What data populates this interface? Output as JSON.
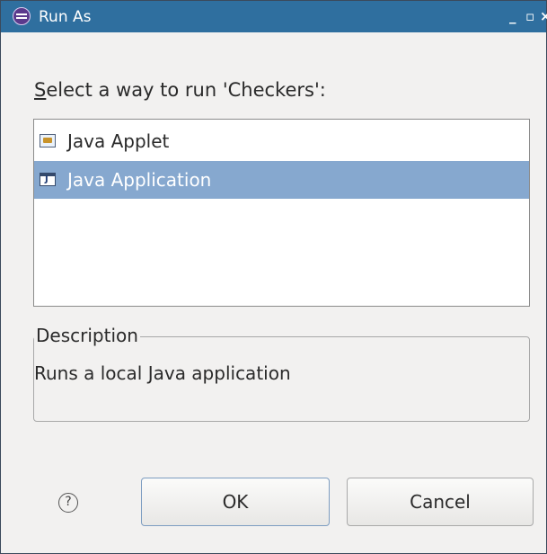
{
  "window": {
    "title": "Run As",
    "controls": [
      "_",
      "▫",
      "×"
    ]
  },
  "prompt": {
    "mnemonic": "S",
    "text_rest": "elect a way to run 'Checkers':"
  },
  "launch_options": [
    {
      "label": "Java Applet",
      "icon": "java-applet-icon",
      "selected": false
    },
    {
      "label": "Java Application",
      "icon": "java-application-icon",
      "selected": true
    }
  ],
  "description": {
    "heading": "Description",
    "text": "Runs a local Java application"
  },
  "buttons": {
    "help": "?",
    "ok": "OK",
    "cancel": "Cancel"
  },
  "colors": {
    "titlebar": "#2f6f9f",
    "selection": "#86a8cf"
  }
}
